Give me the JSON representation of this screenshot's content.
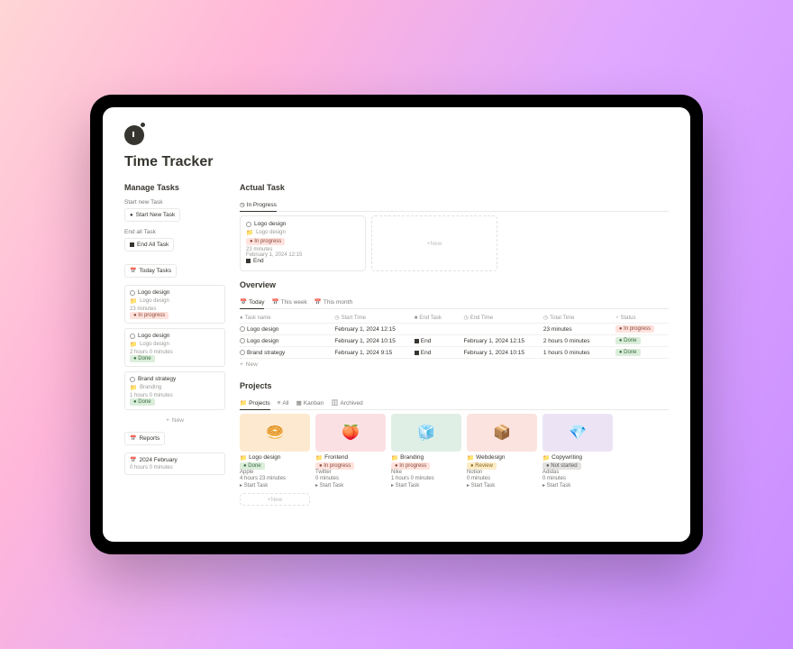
{
  "page": {
    "title": "Time Tracker"
  },
  "sidebar": {
    "heading": "Manage Tasks",
    "start_label": "Start new Task",
    "start_btn": "Start New Task",
    "end_label": "End all Task",
    "end_btn": "End All Task",
    "today_header": "Today Tasks",
    "tasks": [
      {
        "name": "Logo design",
        "project": "Logo design",
        "status": "In progress",
        "statusClass": "b-prog",
        "time": "23 minutes"
      },
      {
        "name": "Logo design",
        "project": "Logo design",
        "time": "2 hours 0 minutes",
        "status": "Done",
        "statusClass": "b-done"
      },
      {
        "name": "Brand strategy",
        "project": "Branding",
        "time": "1 hours 0 minutes",
        "status": "Done",
        "statusClass": "b-done"
      }
    ],
    "new_label": "New",
    "reports_header": "Reports",
    "report_name": "2024 February",
    "report_time": "0 hours 0 minutes"
  },
  "actual": {
    "heading": "Actual Task",
    "tab": "In Progress",
    "card": {
      "name": "Logo design",
      "project": "Logo design",
      "status": "In progress",
      "statusClass": "b-prog",
      "time": "23 minutes",
      "date": "February 1, 2024 12:15",
      "end": "End"
    },
    "new": "New"
  },
  "overview": {
    "heading": "Overview",
    "tabs": [
      "Today",
      "This week",
      "This month"
    ],
    "cols": [
      "Task name",
      "Start Time",
      "End Task",
      "End Time",
      "Total Time",
      "Status"
    ],
    "rows": [
      {
        "name": "Logo design",
        "start": "February 1, 2024 12:15",
        "end": "",
        "endtime": "",
        "total": "23 minutes",
        "status": "In progress",
        "statusClass": "b-prog"
      },
      {
        "name": "Logo design",
        "start": "February 1, 2024 10:15",
        "end": "End",
        "endtime": "February 1, 2024 12:15",
        "total": "2 hours 0 minutes",
        "status": "Done",
        "statusClass": "b-done"
      },
      {
        "name": "Brand strategy",
        "start": "February 1, 2024 9:15",
        "end": "End",
        "endtime": "February 1, 2024 10:15",
        "total": "1 hours 0 minutes",
        "status": "Done",
        "statusClass": "b-done"
      }
    ],
    "new": "New"
  },
  "projects": {
    "heading": "Projects",
    "tabs": [
      "Projects",
      "All",
      "Kanban",
      "Archived"
    ],
    "items": [
      {
        "name": "Logo design",
        "status": "Done",
        "statusClass": "b-done",
        "client": "Apple",
        "time": "4 hours 23 minutes",
        "cover": "pc1",
        "emoji": "🥯"
      },
      {
        "name": "Frontend",
        "status": "In progress",
        "statusClass": "b-prog",
        "client": "Twitter",
        "time": "0 minutes",
        "cover": "pc2",
        "emoji": "🍑"
      },
      {
        "name": "Branding",
        "status": "In progress",
        "statusClass": "b-prog",
        "client": "Nike",
        "time": "1 hours 0 minutes",
        "cover": "pc3",
        "emoji": "🧊"
      },
      {
        "name": "Webdesign",
        "status": "Review",
        "statusClass": "b-review",
        "client": "Notion",
        "time": "0 minutes",
        "cover": "pc4",
        "emoji": "📦"
      },
      {
        "name": "Copywriting",
        "status": "Not started",
        "statusClass": "b-notstarted",
        "client": "Adidas",
        "time": "0 minutes",
        "cover": "pc5",
        "emoji": "💎"
      }
    ],
    "start_task": "Start Task",
    "new": "New"
  }
}
